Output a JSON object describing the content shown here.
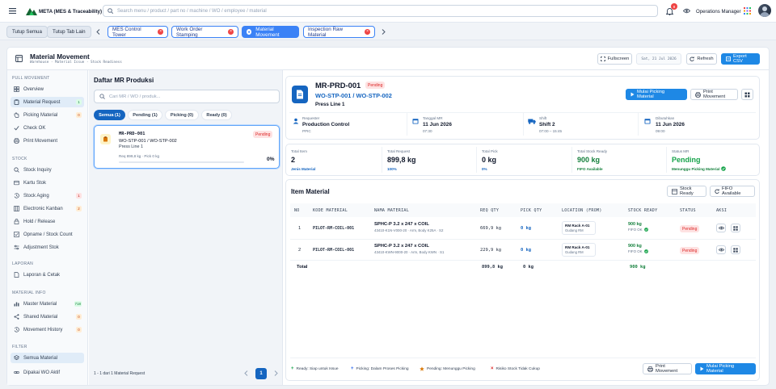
{
  "topbar": {
    "app_name": "META (MES & Traceability)",
    "search_placeholder": "Search menu / product / part no / machine / WO / employee / material",
    "notif_count": "8",
    "user_role": "Operations Manager"
  },
  "tabbar": {
    "close_all": "Tutup Semua",
    "close_others": "Tutup Tab Lain",
    "tabs": [
      {
        "label": "MES Control Tower"
      },
      {
        "label": "Work Order Stamping"
      },
      {
        "label": "Material Movement"
      },
      {
        "label": "Inspection Raw Material"
      }
    ]
  },
  "header": {
    "title": "Material Movement",
    "breadcrumb": "Warehouse · Material Issue · Stock Readiness",
    "fullscreen": "Fullscreen",
    "date": "Sat, 21 Jul 2026",
    "refresh": "Refresh",
    "export": "Export CSV"
  },
  "sidebar": {
    "sections": {
      "pull": "PULL MOVEMENT",
      "stock": "STOCK",
      "laporan": "LAPORAN",
      "material_info": "MATERIAL INFO",
      "filter": "FILTER"
    },
    "items": {
      "overview": "Overview",
      "material_request": "Material Request",
      "material_request_badge": "1",
      "picking_material": "Picking Material",
      "picking_material_badge": "0",
      "check_ok": "Check OK",
      "print_movement": "Print Movement",
      "stock_inquiry": "Stock Inquiry",
      "kartu_stok": "Kartu Stok",
      "stock_aging": "Stock Aging",
      "stock_aging_badge": "1",
      "electronic_kanban": "Electronic Kanban",
      "electronic_kanban_badge": "2",
      "hold_release": "Hold / Release",
      "opname": "Opname / Stock Count",
      "adjustment": "Adjustment Stok",
      "laporan_cetak": "Laporan & Cetak",
      "master_material": "Master Material",
      "master_material_badge": "718",
      "shared_material": "Shared Material",
      "shared_material_badge": "0",
      "movement_history": "Movement History",
      "movement_history_badge": "0",
      "semua_material": "Semua Material",
      "dipakai_wo": "Dipakai WO Aktif"
    }
  },
  "mr_list": {
    "title": "Daftar MR Produksi",
    "search_placeholder": "Cari MR / WO / produk...",
    "filters": [
      "Semua (1)",
      "Pending (1)",
      "Picking (0)",
      "Ready (0)"
    ],
    "card": {
      "id": "MR-PRD-001",
      "status": "Pending",
      "wo": "WO-STP-001 / WO-STP-002",
      "line": "Press Line 1",
      "req": "Req 899,8 kg · Pick 0 kg",
      "percent": "0%",
      "progress": 0
    },
    "pagination_text": "1 - 1 dari 1 Material Request",
    "page": "1"
  },
  "detail": {
    "id": "MR-PRD-001",
    "status": "Pending",
    "wo": "WO-STP-001 / WO-STP-002",
    "line": "Press Line 1",
    "start_picking": "Mulai Picking Material",
    "print_movement": "Print Movement",
    "meta": [
      {
        "label": "Requester",
        "value": "Production Control",
        "sub": "PPIC"
      },
      {
        "label": "Tanggal MR",
        "value": "11 Jun 2026",
        "sub": "07:30"
      },
      {
        "label": "Shift",
        "value": "Shift 2",
        "sub": "07:00 – 15:45"
      },
      {
        "label": "Dibutuhkan",
        "value": "11 Jun 2026",
        "sub": "09:00"
      }
    ],
    "summary": [
      {
        "label": "Total Item",
        "value": "2",
        "sub": "Jenis Material"
      },
      {
        "label": "Total Request",
        "value": "899,8 kg",
        "sub": "100%"
      },
      {
        "label": "Total Pick",
        "value": "0 kg",
        "sub": "0%"
      },
      {
        "label": "Total Stock Ready",
        "value": "900 kg",
        "sub": "FIFO Available"
      },
      {
        "label": "Status MR",
        "value": "Pending",
        "sub": "Menunggu Picking Material"
      }
    ],
    "items_title": "Item Material",
    "stock_ready_btn": "Stock Ready",
    "fifo_btn": "FIFO Available",
    "columns": [
      "NO",
      "KODE MATERIAL",
      "NAMA MATERIAL",
      "REQ QTY",
      "PICK QTY",
      "LOCATION (FROM)",
      "STOCK READY",
      "STATUS",
      "AKSI"
    ],
    "rows": [
      {
        "no": "1",
        "code": "PILOT-RM-COIL-001",
        "name": "SPHC-P 3.2 x 247 x COIL",
        "desc": "43410-K1N-V000-20 · Arm, Body K25A · S2",
        "req": "669,9 kg",
        "pick": "0 kg",
        "loc": "RM Rack A-01",
        "loc_sub": "Gudang RM",
        "stock": "900 kg",
        "fifo": "FIFO OK",
        "status": "Pending"
      },
      {
        "no": "2",
        "code": "PILOT-RM-COIL-001",
        "name": "SPHC-P 3.2 x 247 x COIL",
        "desc": "43410-KWN-9000-20 · Arm, Body KWN · S1",
        "req": "229,9 kg",
        "pick": "0 kg",
        "loc": "RM Rack A-01",
        "loc_sub": "Gudang RM",
        "stock": "900 kg",
        "fifo": "FIFO OK",
        "status": "Pending"
      }
    ],
    "total_label": "Total",
    "total_req": "899,8 kg",
    "total_pick": "0 kg",
    "total_stock": "900 kg",
    "legend": [
      "Ready: Siap untuk Issue",
      "Picking: Dalam Proses Picking",
      "Pending: Menunggu Picking",
      "Risiko Stock Tidak Cukup"
    ],
    "footer_print": "Print Movement",
    "footer_start": "Mulai Picking Material"
  }
}
